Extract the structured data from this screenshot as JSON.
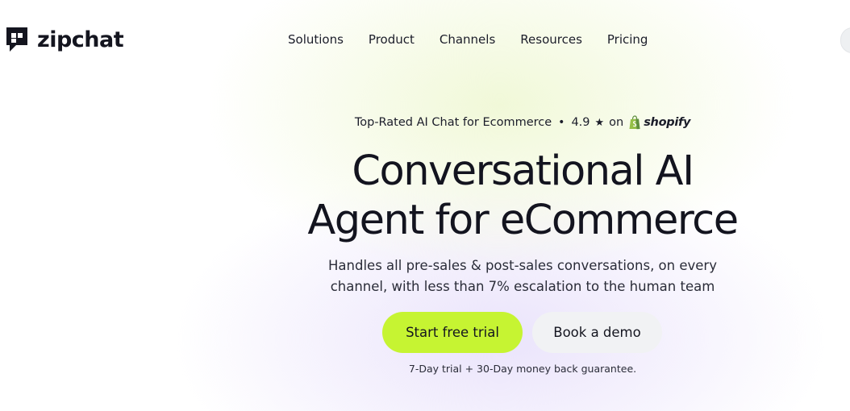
{
  "brand": {
    "name": "zipchat",
    "logo_icon": "zipchat-speech-bubble-logo"
  },
  "nav": {
    "items": [
      {
        "label": "Solutions"
      },
      {
        "label": "Product"
      },
      {
        "label": "Channels"
      },
      {
        "label": "Resources"
      },
      {
        "label": "Pricing"
      }
    ]
  },
  "hero": {
    "rating": {
      "prefix": "Top-Rated AI Chat for Ecommerce",
      "separator": "•",
      "score": "4.9",
      "star_icon": "★",
      "on": "on",
      "platform": "shopify",
      "platform_icon": "shopify-bag-icon"
    },
    "title_line1": "Conversational AI",
    "title_line2": "Agent for eCommerce",
    "subtitle_line1": "Handles all pre-sales & post-sales conversations, on every",
    "subtitle_line2": "channel, with less than 7% escalation to the human team",
    "primary_cta": "Start free trial",
    "secondary_cta": "Book a demo",
    "guarantee": "7-Day trial + 30-Day money back guarantee."
  },
  "colors": {
    "accent_green": "#c6f432",
    "text_dark": "#13141f",
    "secondary_button": "#f1f2f4",
    "shopify_green": "#95bf47"
  }
}
